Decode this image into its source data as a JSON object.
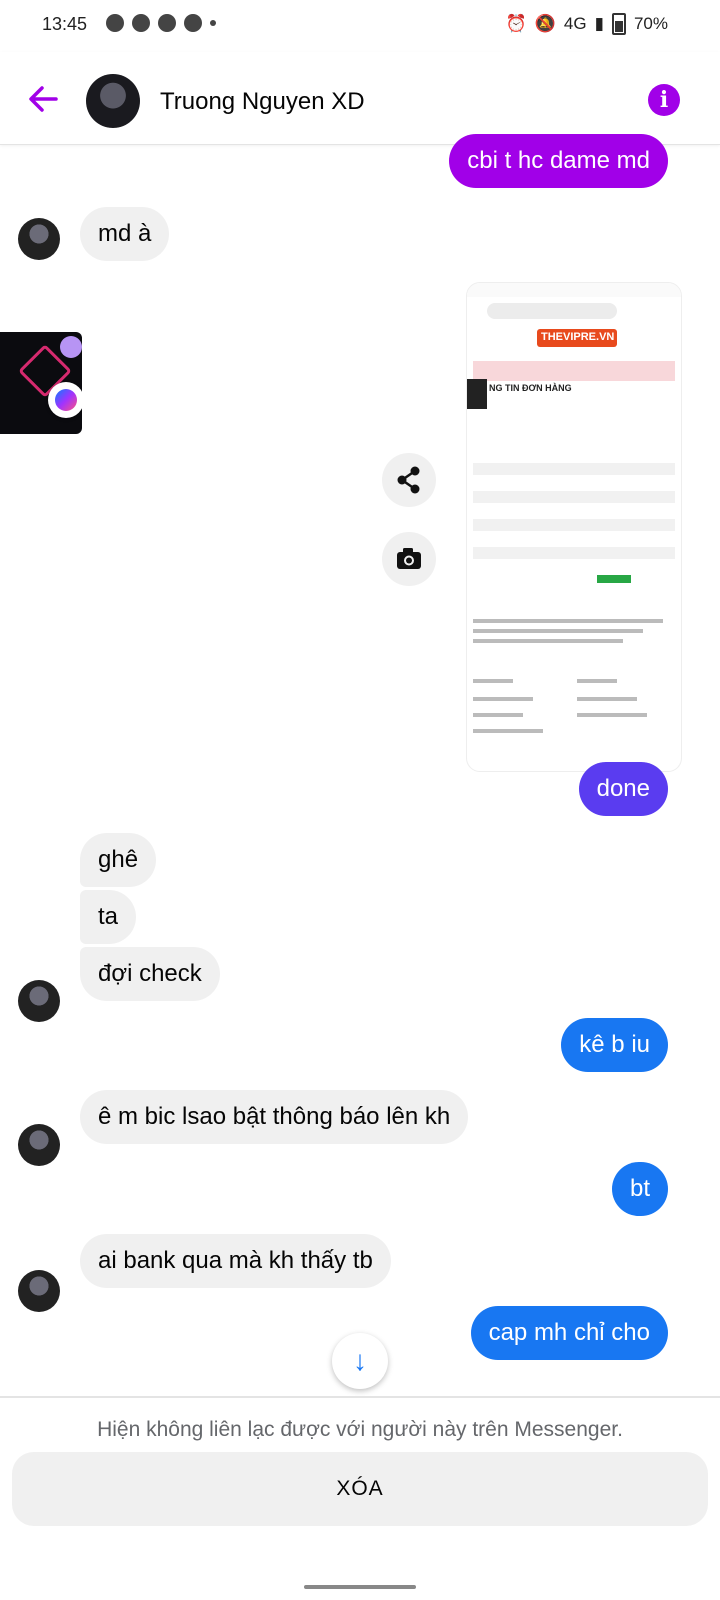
{
  "status_bar": {
    "time": "13:45",
    "network": "4G",
    "battery": "70%",
    "left_icons": [
      "messenger-icon",
      "discord-icon",
      "chat-icon",
      "person-add-icon",
      "dot-icon"
    ],
    "right_icons": [
      "alarm-icon",
      "mute-icon",
      "signal-icon",
      "battery-icon"
    ]
  },
  "header": {
    "contact_name": "Truong Nguyen XD",
    "accent_color": "#a100e8"
  },
  "messages": [
    {
      "from": "me",
      "text": "cbi t hc dame md",
      "color": "#a100e8"
    },
    {
      "from": "them",
      "text": "md à"
    },
    {
      "from": "me",
      "type": "image",
      "description": "shared screenshot"
    },
    {
      "from": "me",
      "text": "done",
      "color": "#5a3cf0"
    },
    {
      "from": "them",
      "text": "ghê"
    },
    {
      "from": "them",
      "text": "ta"
    },
    {
      "from": "them",
      "text": "đợi check"
    },
    {
      "from": "me",
      "text": "kê b iu",
      "color": "#1877f2"
    },
    {
      "from": "them",
      "text": "ê m bic lsao bật thông báo lên kh"
    },
    {
      "from": "me",
      "text": "bt",
      "color": "#1877f2"
    },
    {
      "from": "them",
      "text": "ai bank qua mà kh thấy tb"
    },
    {
      "from": "me",
      "text": "cap mh chỉ cho",
      "color": "#1877f2"
    }
  ],
  "screenshot_image": {
    "site_name": "THEVIPRE.VN",
    "section_title": "NG TIN ĐƠN HÀNG"
  },
  "footer": {
    "notice": "Hiện không liên lạc được với người này trên Messenger.",
    "delete_label": "XÓA"
  }
}
